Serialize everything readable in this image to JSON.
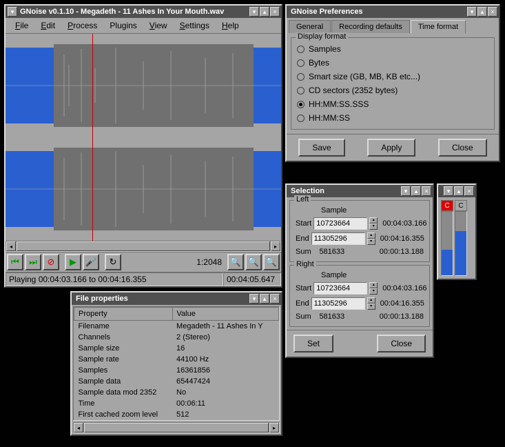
{
  "main": {
    "title": "GNoise v0.1.10 - Megadeth - 11 Ashes In Your Mouth.wav",
    "menu": [
      "File",
      "Edit",
      "Process",
      "Plugins",
      "View",
      "Settings",
      "Help"
    ],
    "zoom": "1:2048",
    "status_playing": "Playing 00:04:03.166 to 00:04:16.355",
    "status_time": "00:04:05.647"
  },
  "prefs": {
    "title": "GNoise Preferences",
    "tabs": [
      "General",
      "Recording defaults",
      "Time format"
    ],
    "active_tab": 2,
    "fieldset": "Display format",
    "options": [
      "Samples",
      "Bytes",
      "Smart size (GB, MB, KB etc...)",
      "CD sectors (2352 bytes)",
      "HH:MM:SS.SSS",
      "HH:MM:SS"
    ],
    "selected": 4,
    "save": "Save",
    "apply": "Apply",
    "close": "Close"
  },
  "selection": {
    "title": "Selection",
    "left_label": "Left",
    "right_label": "Right",
    "sample_label": "Sample",
    "start_label": "Start",
    "end_label": "End",
    "sum_label": "Sum",
    "left": {
      "start": "10723664",
      "start_t": "00:04:03.166",
      "end": "11305296",
      "end_t": "00:04:16.355",
      "sum": "581633",
      "sum_t": "00:00:13.188"
    },
    "right": {
      "start": "10723664",
      "start_t": "00:04:03.166",
      "end": "11305296",
      "end_t": "00:04:16.355",
      "sum": "581633",
      "sum_t": "00:00:13.188"
    },
    "set": "Set",
    "close": "Close"
  },
  "props": {
    "title": "File properties",
    "col_property": "Property",
    "col_value": "Value",
    "rows": [
      [
        "Filename",
        "Megadeth - 11 Ashes In Y"
      ],
      [
        "Channels",
        "2 (Stereo)"
      ],
      [
        "Sample size",
        "16"
      ],
      [
        "Sample rate",
        "44100 Hz"
      ],
      [
        "Samples",
        "16361856"
      ],
      [
        "Sample data",
        "65447424"
      ],
      [
        "Sample data mod 2352",
        "No"
      ],
      [
        "Time",
        "00:06:11"
      ],
      [
        "First cached zoom level",
        "512"
      ]
    ]
  },
  "meter": {
    "c": "C",
    "fill1": 40,
    "fill2": 70
  }
}
